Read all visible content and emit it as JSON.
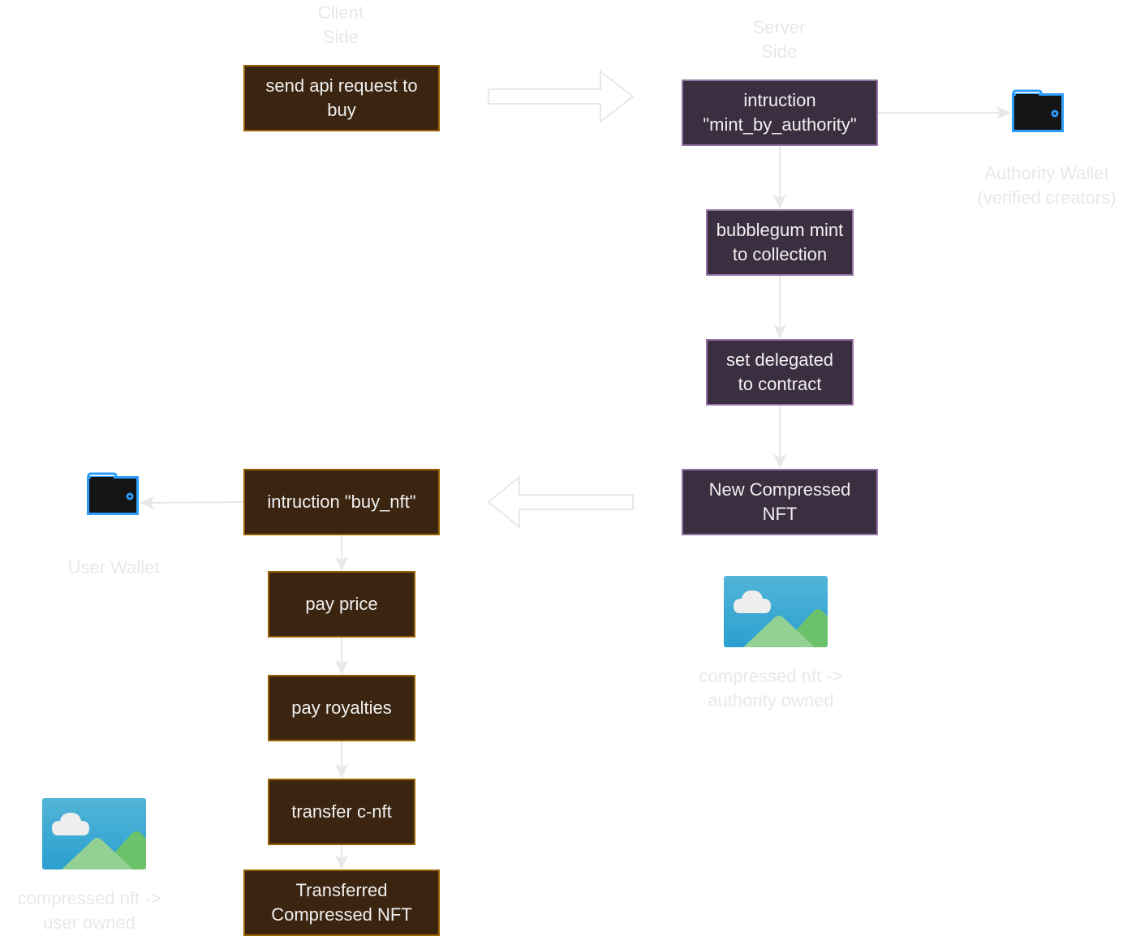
{
  "lanes": {
    "client": "Client\nSide",
    "server": "Server\nSide"
  },
  "colors": {
    "client_fill": "#3b2410",
    "client_stroke": "#996000",
    "server_fill": "#3b2e40",
    "server_stroke": "#9673a6",
    "node_text": "#f0f0f0",
    "edge": "#e8e8e8",
    "caption": "#e8e8e8",
    "wallet_stroke": "#2f9cff",
    "wallet_fill": "#141414"
  },
  "client_nodes": {
    "send_request": "send api request to\nbuy",
    "buy_nft": "intruction \"buy_nft\"",
    "pay_price": "pay price",
    "pay_royalties": "pay royalties",
    "transfer": "transfer c-nft",
    "transferred": "Transferred\nCompressed NFT"
  },
  "server_nodes": {
    "mint_by_authority": "intruction\n\"mint_by_authority\"",
    "bubblegum_mint": "bubblegum mint\nto collection",
    "set_delegated": "set delegated\nto contract",
    "new_cnft": "New Compressed\nNFT"
  },
  "icons": {
    "authority_wallet": {
      "icon": "wallet-icon",
      "caption": "Authority Wallet\n(verified creators)"
    },
    "user_wallet": {
      "icon": "wallet-icon",
      "caption": "User Wallet"
    },
    "authority_nft_image": {
      "icon": "image-icon",
      "caption": "compressed nft ->\nauthority owned"
    },
    "user_nft_image": {
      "icon": "image-icon",
      "caption": "compressed nft ->\nuser owned"
    }
  }
}
